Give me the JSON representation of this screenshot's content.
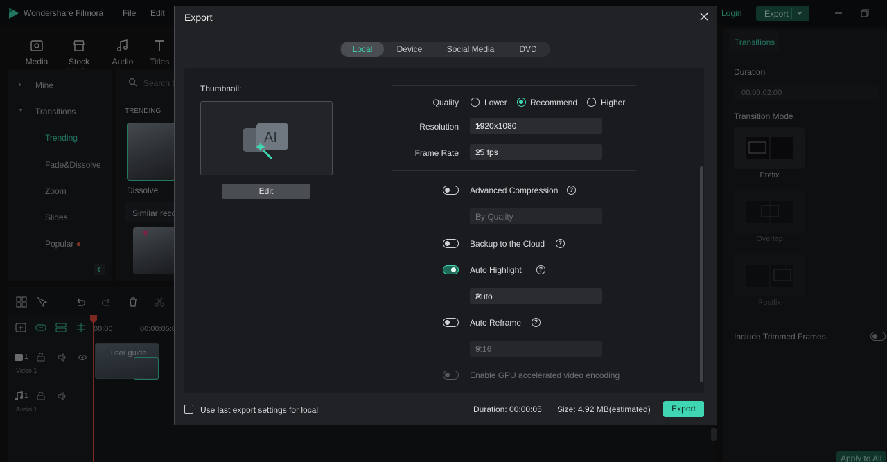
{
  "app": {
    "name": "Wondershare Filmora",
    "menu": [
      "File",
      "Edit"
    ],
    "login": "Login",
    "export": "Export"
  },
  "toolbar": {
    "tabs": [
      "Media",
      "Stock Media",
      "Audio",
      "Titles"
    ]
  },
  "sidebar": {
    "mine": "Mine",
    "transitions": "Transitions",
    "sub": [
      "Trending",
      "Fade&Dissolve",
      "Zoom",
      "Slides",
      "Popular"
    ]
  },
  "library": {
    "search_placeholder": "Search t",
    "section": "TRENDING",
    "item_label": "Dissolve",
    "similar": "Similar reco"
  },
  "timeline": {
    "ruler": [
      "00:00",
      "00:00:05:0"
    ],
    "clip_label": "user guide",
    "video_track": "Video 1",
    "audio_track": "Audio 1",
    "track_num_video": "1",
    "track_num_audio": "1"
  },
  "right_panel": {
    "tab": "Transitions",
    "duration_label": "Duration",
    "duration_value": "00:00:02:00",
    "mode_label": "Transition Mode",
    "modes": [
      "Prefix",
      "Overlap",
      "Postfix"
    ],
    "trimmed": "Include Trimmed Frames",
    "apply": "Apply to All"
  },
  "dialog": {
    "title": "Export",
    "tabs": [
      "Local",
      "Device",
      "Social Media",
      "DVD"
    ],
    "active_tab": "Local",
    "thumbnail_label": "Thumbnail:",
    "edit": "Edit",
    "quality_label": "Quality",
    "quality_options": [
      "Lower",
      "Recommend",
      "Higher"
    ],
    "quality_selected": "Recommend",
    "resolution_label": "Resolution",
    "resolution_value": "1920x1080",
    "framerate_label": "Frame Rate",
    "framerate_value": "25 fps",
    "adv_compression": "Advanced Compression",
    "by_quality": "By Quality",
    "backup_cloud": "Backup to the Cloud",
    "auto_highlight": "Auto Highlight",
    "auto_value": "Auto",
    "auto_reframe": "Auto Reframe",
    "aspect_value": "9:16",
    "gpu": "Enable GPU accelerated video encoding",
    "last_settings": "Use last export settings for local",
    "duration": "Duration:  00:00:05",
    "size": "Size:  4.92 MB(estimated)",
    "export": "Export"
  },
  "colors": {
    "accent": "#3fd7b3",
    "dialog_bg": "#212225",
    "app_bg": "#141517"
  }
}
